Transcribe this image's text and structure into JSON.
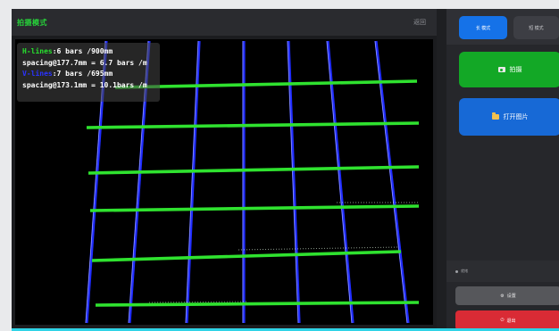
{
  "topbar": {
    "title": "拍摄模式",
    "back_label": "返回"
  },
  "overlay": {
    "h_key": "H-lines",
    "h_count": ":6 bars /900mm",
    "h_spacing": "spacing@177.7mm = 6.7 bars /m",
    "v_key": "V-lines",
    "v_count": ":7 bars /695mm",
    "v_spacing": "spacing@173.1mm = 10.1bars /m"
  },
  "sidebar": {
    "mode_active_label": "长 模式",
    "mode_idle_label": "短 模式",
    "capture_label": "拍摄",
    "open_label": "打开图片",
    "status_label": "就绪",
    "settings_label": "设置",
    "exit_label": "退出"
  },
  "icons": {
    "capture": "camera-icon",
    "open": "folder-icon",
    "settings": "gear-icon",
    "exit": "power-icon"
  },
  "colors": {
    "mode_title": "#27d43a",
    "h_lines": "#2fe22f",
    "v_lines": "#2a33ff",
    "capture_button": "#13a826",
    "open_button": "#1769d6",
    "exit_button": "#d92b35",
    "active_mode": "#1572e8"
  }
}
